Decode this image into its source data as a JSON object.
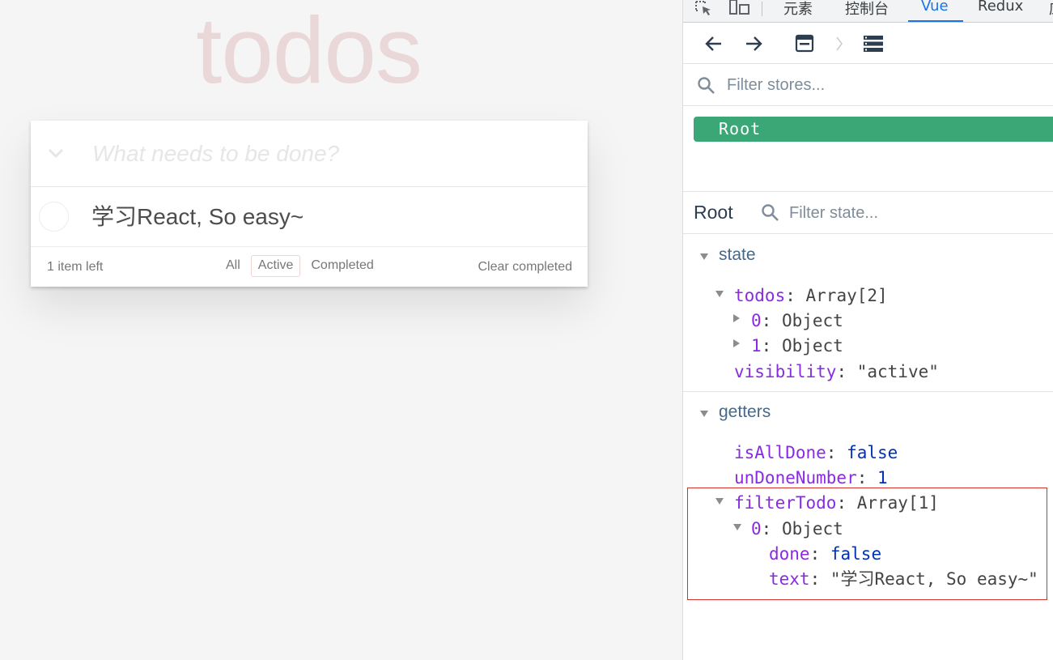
{
  "todo_app": {
    "title": "todos",
    "new_todo_placeholder": "What needs to be done?",
    "items": [
      {
        "text": "学习React, So easy~",
        "done": false
      }
    ],
    "footer": {
      "count_text": "1 item left",
      "filters": [
        "All",
        "Active",
        "Completed"
      ],
      "selected_filter": "Active",
      "clear_completed_label": "Clear completed"
    }
  },
  "devtools": {
    "tabs": [
      "元素",
      "控制台",
      "Vue",
      "Redux",
      "应"
    ],
    "active_tab": "Vue",
    "toolbar": {
      "back_icon": "arrow-left-icon",
      "forward_icon": "arrow-right-icon",
      "component_icon": "window-icon",
      "chevron_icon": "chevron-right-icon",
      "vuex_icon": "list-icon"
    },
    "store_filter_placeholder": "Filter stores...",
    "stores": [
      "Root"
    ],
    "selected_store": "Root",
    "state_panel_title": "Root",
    "state_filter_placeholder": "Filter state...",
    "state": {
      "section_label": "state",
      "todos_key": "todos",
      "todos_type": "Array[2]",
      "todos_items": [
        {
          "index": "0",
          "type": "Object"
        },
        {
          "index": "1",
          "type": "Object"
        }
      ],
      "visibility_key": "visibility",
      "visibility_value": "\"active\""
    },
    "getters": {
      "section_label": "getters",
      "isAllDone_key": "isAllDone",
      "isAllDone_value": "false",
      "unDoneNumber_key": "unDoneNumber",
      "unDoneNumber_value": "1",
      "filterTodo_key": "filterTodo",
      "filterTodo_type": "Array[1]",
      "filterTodo_item_index": "0",
      "filterTodo_item_type": "Object",
      "done_key": "done",
      "done_value": "false",
      "text_key": "text",
      "text_value": "\"学习React, So easy~\""
    }
  },
  "colors": {
    "accent_green": "#3ba776",
    "devtools_active_tab": "#1a73e8",
    "highlight_border": "#d9302e",
    "todo_title": "#ead7d7"
  }
}
